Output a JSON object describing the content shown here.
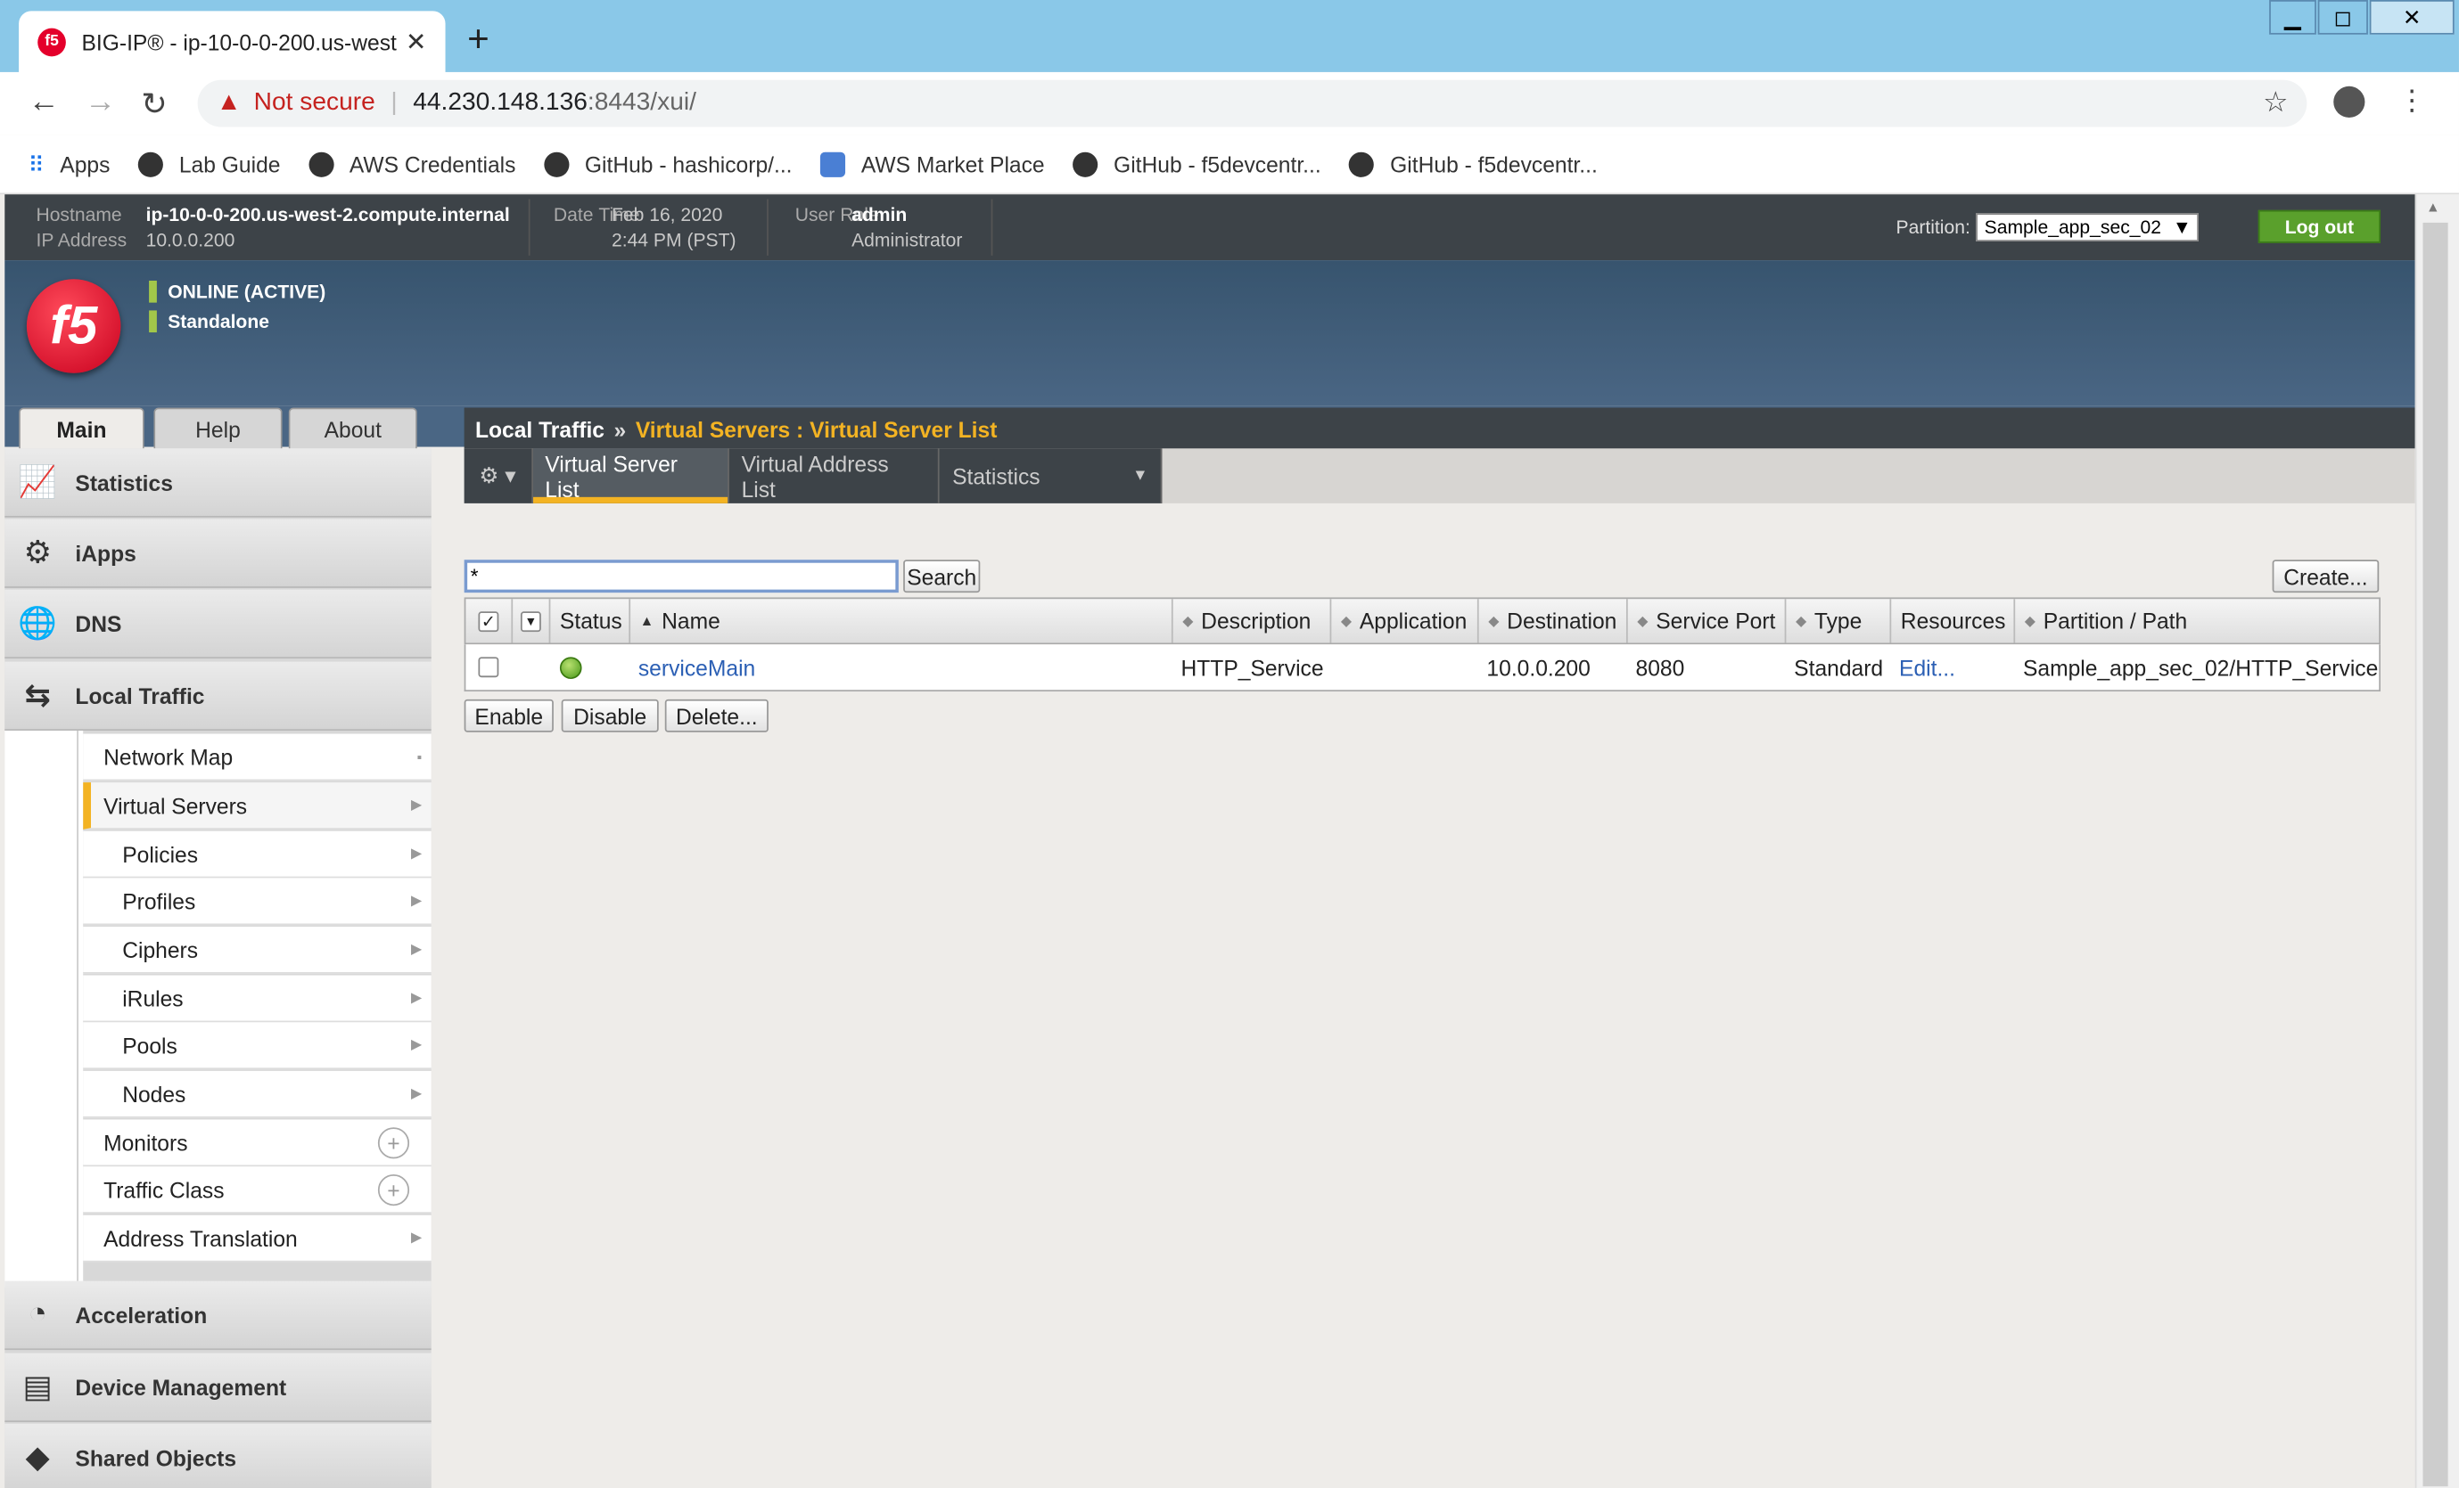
{
  "browser": {
    "tab_title": "BIG-IP® - ip-10-0-0-200.us-west",
    "tab_close": "✕",
    "new_tab": "+",
    "url_warning": "Not secure",
    "url_host": "44.230.148.136",
    "url_path": ":8443/xui/",
    "bookmarks": [
      {
        "label": "Apps",
        "icon": "apps-grid-icon"
      },
      {
        "label": "Lab Guide",
        "icon": "globe-icon"
      },
      {
        "label": "AWS Credentials",
        "icon": "globe-icon"
      },
      {
        "label": "GitHub - hashicorp/...",
        "icon": "github-icon"
      },
      {
        "label": "AWS Market Place",
        "icon": "aws-icon"
      },
      {
        "label": "GitHub - f5devcentr...",
        "icon": "github-icon"
      },
      {
        "label": "GitHub - f5devcentr...",
        "icon": "github-icon"
      }
    ]
  },
  "header": {
    "hostname_label": "Hostname",
    "hostname": "ip-10-0-0-200.us-west-2.compute.internal",
    "ip_label": "IP Address",
    "ip": "10.0.0.200",
    "date_label": "Date",
    "date": "Feb 16, 2020",
    "time_label": "Time",
    "time": "2:44 PM (PST)",
    "user_label": "User",
    "user": "admin",
    "role_label": "Role",
    "role": "Administrator",
    "partition_label": "Partition:",
    "partition_value": "Sample_app_sec_02",
    "logout_label": "Log out"
  },
  "banner": {
    "logo": "f5",
    "status": "ONLINE (ACTIVE)",
    "mode": "Standalone"
  },
  "main_tabs": [
    "Main",
    "Help",
    "About"
  ],
  "breadcrumb": {
    "section": "Local Traffic",
    "separator": "»",
    "page": "Virtual Servers : Virtual Server List"
  },
  "sidebar": {
    "sections": [
      "Statistics",
      "iApps",
      "DNS",
      "Local Traffic"
    ],
    "local_traffic_items": [
      "Network Map",
      "Virtual Servers",
      "Policies",
      "Profiles",
      "Ciphers",
      "iRules",
      "Pools",
      "Nodes",
      "Monitors",
      "Traffic Class",
      "Address Translation"
    ],
    "bottom_sections": [
      "Acceleration",
      "Device Management",
      "Shared Objects"
    ]
  },
  "subtabs": [
    "Virtual Server List",
    "Virtual Address List",
    "Statistics"
  ],
  "toolbar": {
    "search_value": "*",
    "search_button": "Search",
    "create_button": "Create..."
  },
  "table": {
    "headers": [
      "Status",
      "Name",
      "Description",
      "Application",
      "Destination",
      "Service Port",
      "Type",
      "Resources",
      "Partition / Path"
    ],
    "rows": [
      {
        "name": "serviceMain",
        "description": "HTTP_Service",
        "application": "",
        "destination": "10.0.0.200",
        "service_port": "8080",
        "type": "Standard",
        "resources": "Edit...",
        "partition_path": "Sample_app_sec_02/HTTP_Service"
      }
    ]
  },
  "actions": {
    "enable": "Enable",
    "disable": "Disable",
    "delete": "Delete..."
  }
}
